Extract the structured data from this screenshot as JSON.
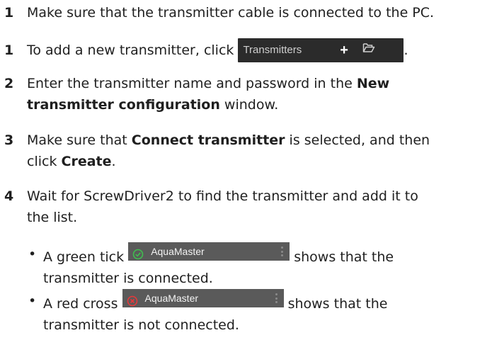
{
  "steps": [
    {
      "num": "1",
      "text": "Make sure that the transmitter cable is connected to the PC."
    },
    {
      "num": "1",
      "text_before": "To add a new transmitter, click",
      "text_after": "."
    },
    {
      "num": "2",
      "line1_before": "Enter the transmitter name and password in the",
      "line1_bold": "New",
      "line2_bold": "transmitter configuration",
      "line2_after": "window."
    },
    {
      "num": "3",
      "line1_before": "Make sure that",
      "line1_bold": "Connect transmitter",
      "line1_after": "is selected, and then",
      "line2_before": "click",
      "line2_bold": "Create",
      "line2_after": "."
    },
    {
      "num": "4",
      "line1": "Wait for ScrewDriver2 to find the transmitter and add it to",
      "line2": "the list."
    }
  ],
  "toolbar": {
    "label": "Transmitters",
    "plus": "+",
    "icons": {
      "plus": "plus-icon",
      "folder": "folder-open-icon"
    }
  },
  "bullets": [
    {
      "bullet": "•",
      "before": "A green tick",
      "chip_label": "AquaMaster",
      "icon": "green-check-circle-icon",
      "icon_color": "#3fbf4f",
      "after": "shows that the",
      "line2": "transmitter is connected."
    },
    {
      "bullet": "•",
      "before": "A red cross",
      "chip_label": "AquaMaster",
      "icon": "red-cross-circle-icon",
      "icon_color": "#e8383a",
      "after": "shows that the",
      "line2": "transmitter is not connected."
    }
  ],
  "colors": {
    "text": "#1f1f1f",
    "toolbar_bg": "#2b2b2b",
    "chip_bg": "#5a5a5a"
  }
}
